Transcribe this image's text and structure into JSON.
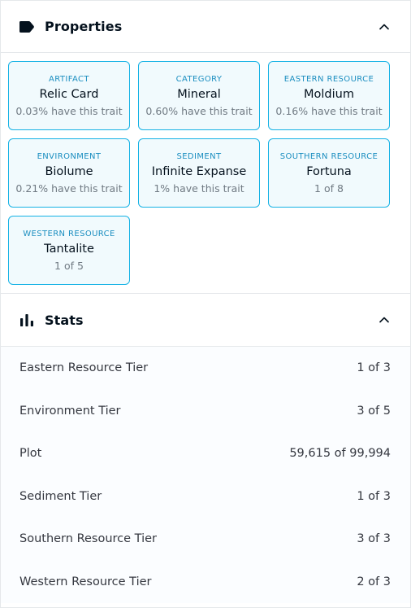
{
  "properties": {
    "title": "Properties",
    "icon": "tag-icon",
    "collapse_icon": "chevron-up-icon",
    "traits": [
      {
        "type": "ARTIFACT",
        "value": "Relic Card",
        "rarity": "0.03% have this trait"
      },
      {
        "type": "CATEGORY",
        "value": "Mineral",
        "rarity": "0.60% have this trait"
      },
      {
        "type": "EASTERN RESOURCE",
        "value": "Moldium",
        "rarity": "0.16% have this trait"
      },
      {
        "type": "ENVIRONMENT",
        "value": "Biolume",
        "rarity": "0.21% have this trait"
      },
      {
        "type": "SEDIMENT",
        "value": "Infinite Expanse",
        "rarity": "1% have this trait"
      },
      {
        "type": "SOUTHERN RESOURCE",
        "value": "Fortuna",
        "rarity": "1 of 8"
      },
      {
        "type": "WESTERN RESOURCE",
        "value": "Tantalite",
        "rarity": "1 of 5"
      }
    ]
  },
  "stats": {
    "title": "Stats",
    "icon": "bar-chart-icon",
    "collapse_icon": "chevron-up-icon",
    "rows": [
      {
        "label": "Eastern Resource Tier",
        "value": "1 of 3"
      },
      {
        "label": "Environment Tier",
        "value": "3 of 5"
      },
      {
        "label": "Plot",
        "value": "59,615 of 99,994"
      },
      {
        "label": "Sediment Tier",
        "value": "1 of 3"
      },
      {
        "label": "Southern Resource Tier",
        "value": "3 of 3"
      },
      {
        "label": "Western Resource Tier",
        "value": "2 of 3"
      }
    ]
  },
  "colors": {
    "accent": "#15b2e5",
    "trait_bg": "#f0f9fd",
    "text": "#04111d",
    "muted": "#707a83",
    "border": "#e5e8eb"
  }
}
